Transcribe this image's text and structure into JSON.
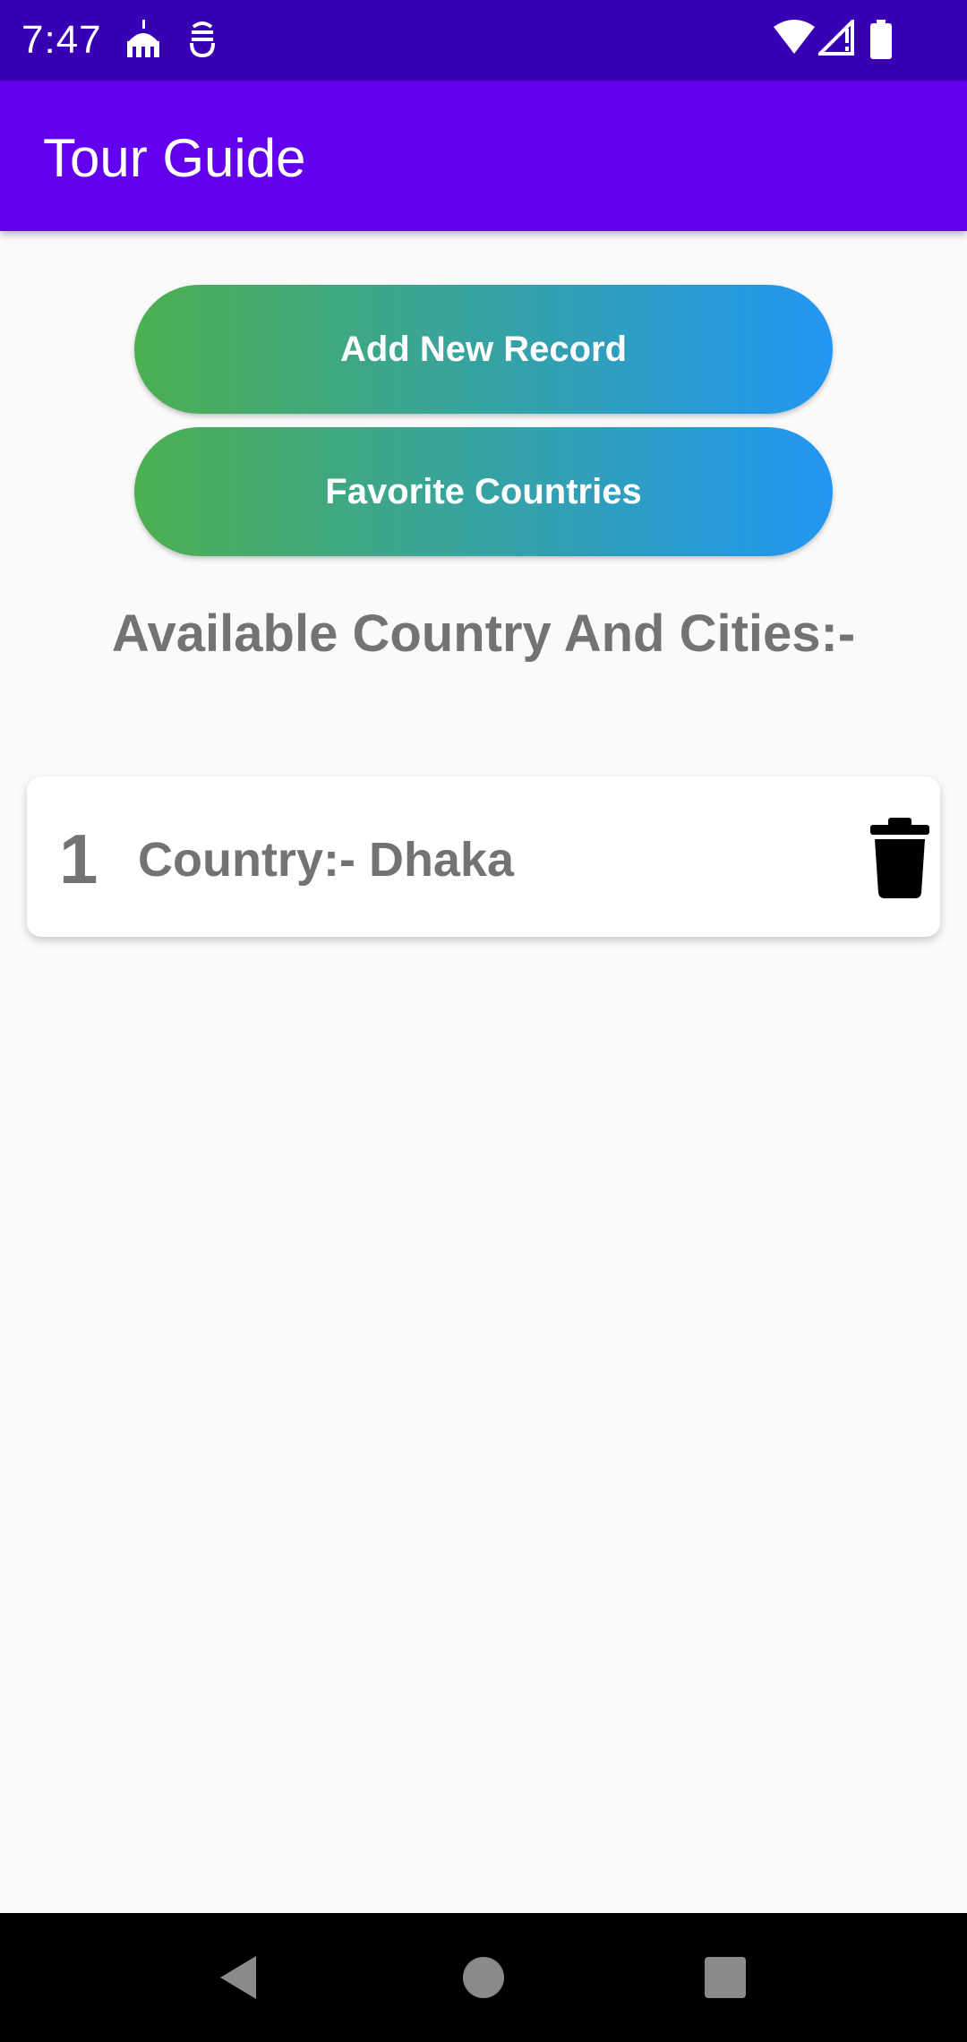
{
  "status_bar": {
    "time": "7:47",
    "icons": [
      "mosque-icon",
      "app-notification-icon",
      "wifi-icon",
      "signal-icon",
      "battery-icon"
    ]
  },
  "app_bar": {
    "title": "Tour Guide"
  },
  "buttons": {
    "add_new_record": "Add New Record",
    "favorite_countries": "Favorite Countries"
  },
  "heading": "Available Country And Cities:-",
  "records": [
    {
      "index": "1",
      "country": "Country:- Dhaka"
    }
  ],
  "nav_bar": {
    "icons": [
      "back-icon",
      "home-icon",
      "recents-icon"
    ]
  },
  "colors": {
    "status_bar": "#3700b3",
    "app_bar": "#6200ee",
    "gradient_start": "#4caf50",
    "gradient_end": "#2196f3",
    "text_gray": "#737373",
    "background": "#fafafa"
  }
}
